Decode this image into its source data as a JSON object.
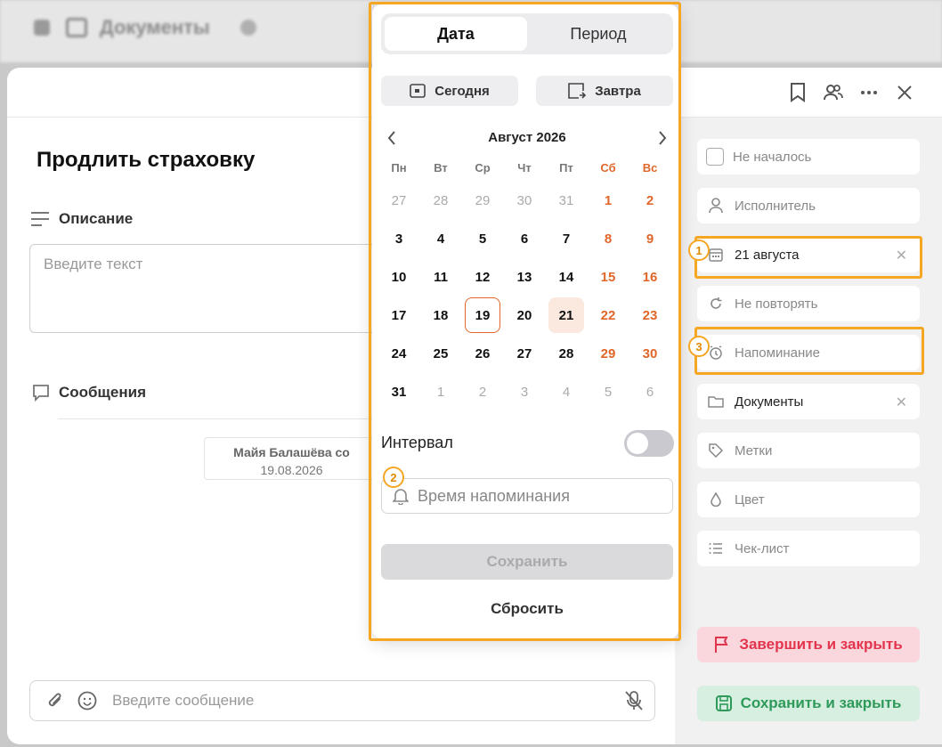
{
  "background": {
    "title": "Документы"
  },
  "task": {
    "title": "Продлить страховку",
    "description_label": "Описание",
    "description_placeholder": "Введите текст",
    "messages_label": "Сообщения",
    "message": {
      "author": "Майя Балашёва со",
      "date": "19.08.2026"
    },
    "composer_placeholder": "Введите сообщение"
  },
  "header_icons": [
    "bookmark-icon",
    "users-icon",
    "more-icon",
    "close-icon"
  ],
  "popup": {
    "tabs": [
      "Дата",
      "Период"
    ],
    "active_tab": "Дата",
    "quick": {
      "today": "Сегодня",
      "tomorrow": "Завтра"
    },
    "month_title": "Август 2026",
    "weekdays": [
      "Пн",
      "Вт",
      "Ср",
      "Чт",
      "Пт",
      "Сб",
      "Вс"
    ],
    "weeks": [
      [
        "27",
        "28",
        "29",
        "30",
        "31",
        "1",
        "2"
      ],
      [
        "3",
        "4",
        "5",
        "6",
        "7",
        "8",
        "9"
      ],
      [
        "10",
        "11",
        "12",
        "13",
        "14",
        "15",
        "16"
      ],
      [
        "17",
        "18",
        "19",
        "20",
        "21",
        "22",
        "23"
      ],
      [
        "24",
        "25",
        "26",
        "27",
        "28",
        "29",
        "30"
      ],
      [
        "31",
        "1",
        "2",
        "3",
        "4",
        "5",
        "6"
      ]
    ],
    "today_day": "19",
    "selected_day": "21",
    "interval_label": "Интервал",
    "interval_on": false,
    "reminder_placeholder": "Время напоминания",
    "save_label": "Сохранить",
    "reset_label": "Сбросить"
  },
  "right_panel": {
    "status": "Не началось",
    "assignee": "Исполнитель",
    "date": "21 августа",
    "repeat": "Не повторять",
    "reminder": "Напоминание",
    "folder": "Документы",
    "tags": "Метки",
    "color": "Цвет",
    "checklist": "Чек-лист",
    "finish_label": "Завершить и закрыть",
    "save_close_label": "Сохранить и закрыть"
  },
  "annotations": [
    "1",
    "2",
    "3"
  ],
  "colors": {
    "accent": "#e0662a",
    "highlight": "#f5a623",
    "finish_bg": "#f9d7dc",
    "finish_text": "#e3344d",
    "save_bg": "#d6efe0",
    "save_text": "#2e9a5a"
  }
}
